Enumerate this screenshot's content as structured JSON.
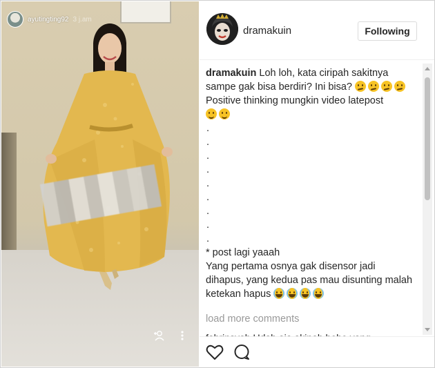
{
  "story": {
    "username": "ayutingting92",
    "time": "3 j.am",
    "icons": [
      "add-person-icon",
      "more-vertical-icon"
    ]
  },
  "post": {
    "username": "dramakuin",
    "follow_label": "Following",
    "comment": {
      "author": "dramakuin",
      "line1": "Loh loh, kata ciripah sakitnya sampe gak bisa berdiri? Ini bisa?",
      "line2": "Positive thinking mungkin video latepost",
      "dots": [
        ".",
        ".",
        ".",
        ".",
        ".",
        ".",
        ".",
        ".",
        "."
      ],
      "line3": "* post lagi yaaah",
      "line4": "Yang pertama osnya gak disensor jadi dihapus, yang kedua pas mau disunting malah ketekan hapus"
    },
    "load_more": "load more comments",
    "cut_text": "fahrinsyah   Udah aja akinah hehe yang",
    "action_icons": [
      "heart-icon",
      "comment-icon"
    ]
  },
  "colors": {
    "text": "#262626",
    "muted": "#999999",
    "border": "#dbdbdb",
    "dress": "#e3b84f"
  }
}
